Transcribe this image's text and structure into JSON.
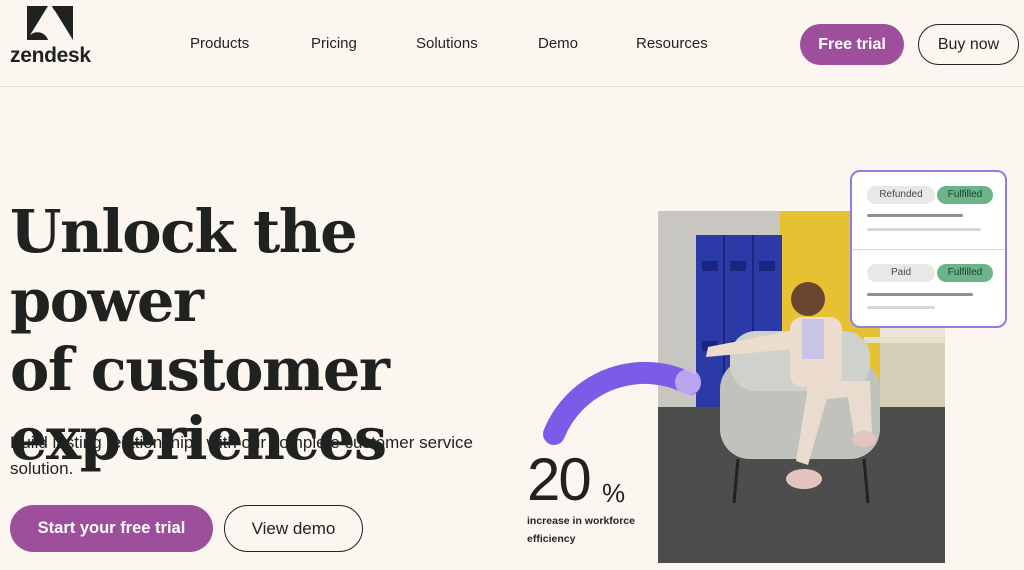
{
  "brand": {
    "name": "zendesk"
  },
  "nav": [
    {
      "label": "Products"
    },
    {
      "label": "Pricing"
    },
    {
      "label": "Solutions"
    },
    {
      "label": "Demo"
    },
    {
      "label": "Resources"
    }
  ],
  "header_cta": {
    "free_trial": "Free trial",
    "buy_now": "Buy now"
  },
  "hero": {
    "title_line1": "Unlock the power",
    "title_line2": "of customer",
    "title_line3": "experiences",
    "subtitle": "Build lasting relationships with our complete customer service solution.",
    "primary_cta": "Start your free trial",
    "secondary_cta": "View demo"
  },
  "status_card": {
    "row1": {
      "left": "Refunded",
      "right": "Fulfilled"
    },
    "row2": {
      "left": "Paid",
      "right": "Fulfilled"
    }
  },
  "stat": {
    "value": "20",
    "unit": "%",
    "label": "increase in workforce efficiency",
    "progress_fraction": 0.2
  },
  "colors": {
    "accent_purple": "#9d4f9c",
    "arc_purple": "#7b5ce8",
    "pill_green": "#6cb38a",
    "background": "#fbf7f0"
  }
}
